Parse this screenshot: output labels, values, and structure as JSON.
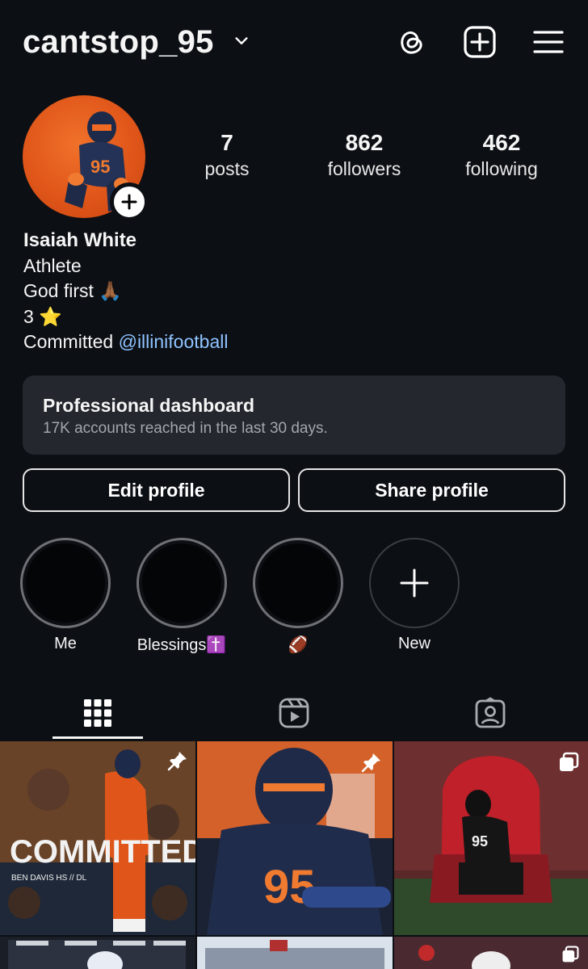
{
  "header": {
    "username": "cantstop_95",
    "icons": [
      "chevron-down-icon",
      "threads-icon",
      "new-post-icon",
      "menu-icon"
    ]
  },
  "profile": {
    "stats": [
      {
        "value": "7",
        "label": "posts"
      },
      {
        "value": "862",
        "label": "followers"
      },
      {
        "value": "462",
        "label": "following"
      }
    ],
    "name": "Isaiah White",
    "category": "Athlete",
    "bio_line1": "God first 🙏🏾",
    "bio_line2": "3 ⭐",
    "bio_line3_prefix": "Committed ",
    "bio_mention": "@illinifootball"
  },
  "dashboard": {
    "title": "Professional dashboard",
    "subtitle": "17K accounts reached in the last 30 days."
  },
  "buttons": {
    "edit": "Edit profile",
    "share": "Share profile"
  },
  "highlights": [
    {
      "label": "Me"
    },
    {
      "label": "Blessings✝️"
    },
    {
      "label": "🏈"
    },
    {
      "label": "New"
    }
  ],
  "tabs": [
    "grid-icon",
    "reels-icon",
    "tagged-icon"
  ],
  "grid_posts": [
    {
      "text": "COMMITTED",
      "pinned": true
    },
    {
      "text": "95",
      "pinned": true
    },
    {
      "text": "95",
      "multi": true
    }
  ],
  "colors": {
    "background": "#0c0f14",
    "mention": "#8fc3ff",
    "card": "#24272d",
    "illini_orange": "#e0561a"
  }
}
